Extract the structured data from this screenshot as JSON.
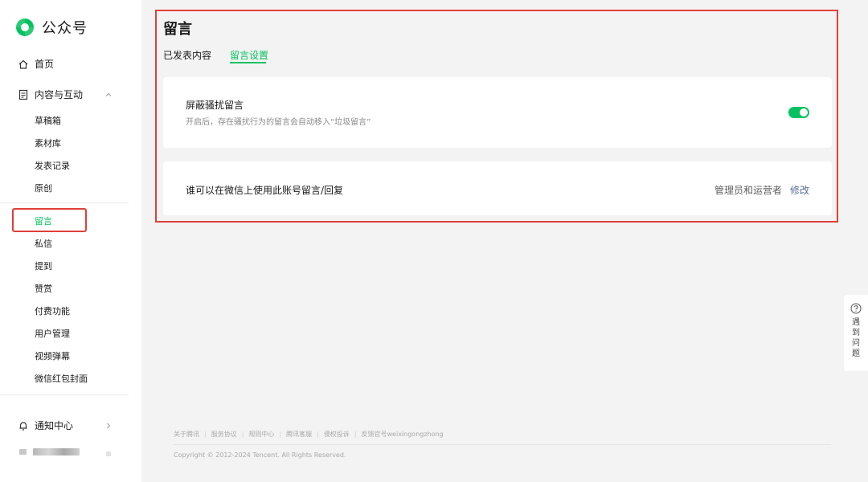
{
  "brand": {
    "name": "公众号",
    "accent": "#07c160"
  },
  "sidebar": {
    "home": {
      "label": "首页",
      "icon": "home-icon"
    },
    "content": {
      "label": "内容与互动",
      "icon": "document-icon",
      "expanded": true
    },
    "sub_items": [
      {
        "label": "草稿箱"
      },
      {
        "label": "素材库"
      },
      {
        "label": "发表记录"
      },
      {
        "label": "原创"
      },
      {
        "label": "留言",
        "active": true
      },
      {
        "label": "私信"
      },
      {
        "label": "提到"
      },
      {
        "label": "赞赏"
      },
      {
        "label": "付费功能"
      },
      {
        "label": "用户管理"
      },
      {
        "label": "视频弹幕"
      },
      {
        "label": "微信红包封面"
      }
    ],
    "notification": {
      "label": "通知中心",
      "icon": "bell-icon"
    }
  },
  "page": {
    "title": "留言",
    "tabs": [
      {
        "label": "已发表内容",
        "active": false
      },
      {
        "label": "留言设置",
        "active": true
      }
    ]
  },
  "settings": {
    "block_spam": {
      "title": "屏蔽骚扰留言",
      "description": "开启后，存在骚扰行为的留言会自动移入“垃圾留言”",
      "enabled": true
    },
    "comment_permission": {
      "title": "谁可以在微信上使用此账号留言/回复",
      "value": "管理员和运营者",
      "edit_label": "修改"
    }
  },
  "footer": {
    "links": [
      "关于腾讯",
      "服务协议",
      "规则中心",
      "腾讯客服",
      "侵权投诉",
      "反馈官号weixingongzhong"
    ],
    "copyright": "Copyright © 2012-2024 Tencent. All Rights Reserved."
  },
  "help": {
    "label": "遇到问题",
    "icon": "question-icon"
  }
}
